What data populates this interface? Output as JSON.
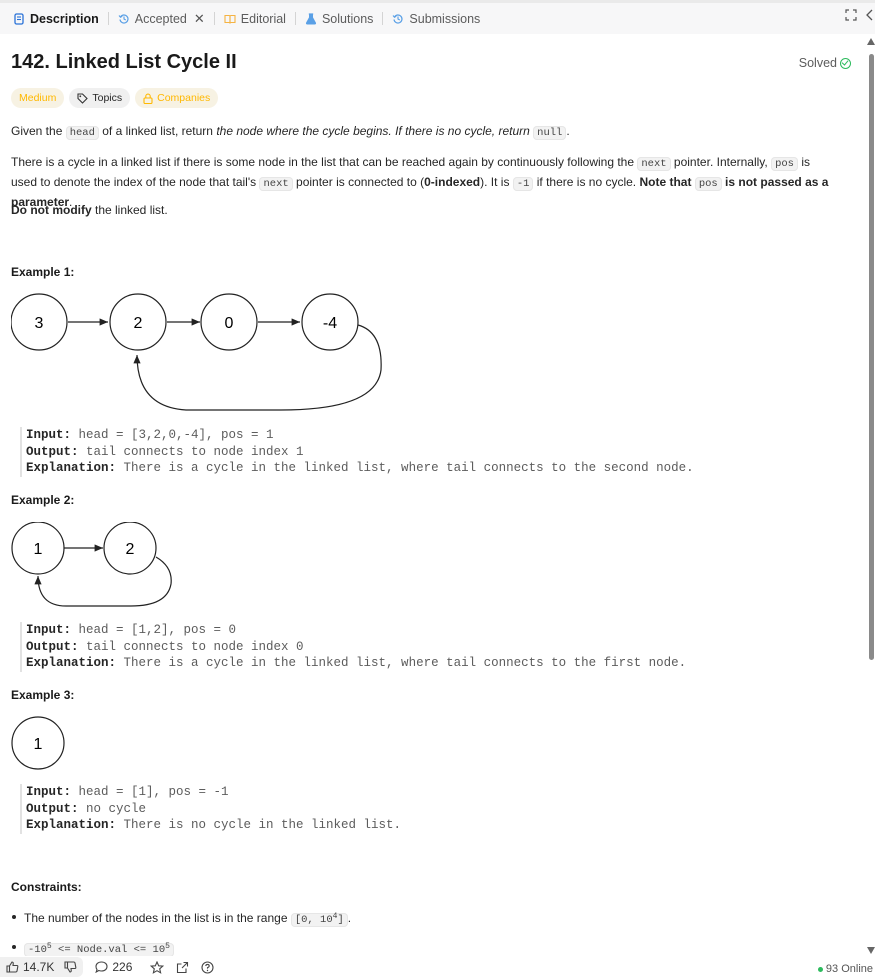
{
  "tabs": [
    {
      "label": "Description",
      "icon": "description-icon",
      "active": true
    },
    {
      "label": "Accepted",
      "icon": "history-icon",
      "closable": true
    },
    {
      "label": "Editorial",
      "icon": "book-icon"
    },
    {
      "label": "Solutions",
      "icon": "flask-icon"
    },
    {
      "label": "Submissions",
      "icon": "history-icon"
    }
  ],
  "problem": {
    "title": "142. Linked List Cycle II",
    "status": "Solved",
    "tags": {
      "difficulty": "Medium",
      "topics": "Topics",
      "companies": "Companies"
    }
  },
  "description": {
    "p1": {
      "t1": "Given the ",
      "c1": "head",
      "t2": " of a linked list, return ",
      "em1": "the node where the cycle begins. If there is no cycle, return ",
      "c2": "null",
      "t3": "."
    },
    "p2": {
      "t1": "There is a cycle in a linked list if there is some node in the list that can be reached again by continuously following the ",
      "c1": "next",
      "t2": " pointer. Internally, ",
      "c2": "pos",
      "t3": " is used to denote the index of the node that tail's ",
      "c3": "next",
      "t4": " pointer is connected to (",
      "b1": "0-indexed",
      "t5": "). It is ",
      "c4": "-1",
      "t6": " if there is no cycle. ",
      "b2": "Note that ",
      "c5": "pos",
      "b3": " is not passed as a parameter",
      "t7": "."
    },
    "p3": {
      "b1": "Do not modify",
      "t1": " the linked list."
    }
  },
  "examples": [
    {
      "heading": "Example 1:",
      "nodes": [
        "3",
        "2",
        "0",
        "-4"
      ],
      "input_label": "Input:",
      "input": " head = [3,2,0,-4], pos = 1",
      "output_label": "Output:",
      "output": " tail connects to node index 1",
      "expl_label": "Explanation:",
      "explanation": " There is a cycle in the linked list, where tail connects to the second node."
    },
    {
      "heading": "Example 2:",
      "nodes": [
        "1",
        "2"
      ],
      "input_label": "Input:",
      "input": " head = [1,2], pos = 0",
      "output_label": "Output:",
      "output": " tail connects to node index 0",
      "expl_label": "Explanation:",
      "explanation": " There is a cycle in the linked list, where tail connects to the first node."
    },
    {
      "heading": "Example 3:",
      "nodes": [
        "1"
      ],
      "input_label": "Input:",
      "input": " head = [1], pos = -1",
      "output_label": "Output:",
      "output": " no cycle",
      "expl_label": "Explanation:",
      "explanation": " There is no cycle in the linked list."
    }
  ],
  "constraints": {
    "heading": "Constraints:",
    "c1": {
      "text": "The number of the nodes in the list is in the range ",
      "code_pre": "[0, 10",
      "sup": "4",
      "code_post": "]",
      "tail": "."
    },
    "c2": {
      "code_pre": "-10",
      "sup1": "5",
      "code_mid": " <= Node.val <= 10",
      "sup2": "5"
    }
  },
  "footer": {
    "likes": "14.7K",
    "comments": "226",
    "online": "93 Online"
  },
  "colors": {
    "medium": "#ffb800",
    "solved": "#2cbb5d",
    "accent": "#1a1a1a"
  }
}
